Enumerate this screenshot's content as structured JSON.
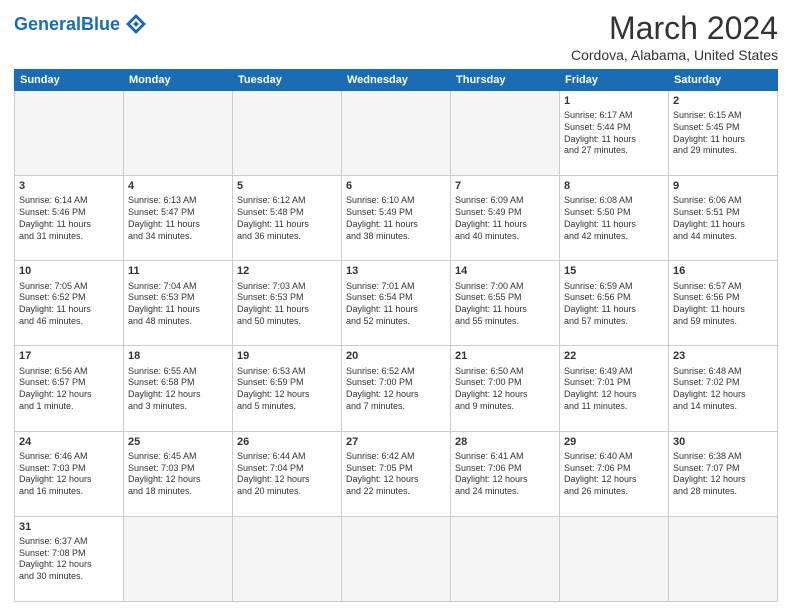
{
  "header": {
    "logo_general": "General",
    "logo_blue": "Blue",
    "month_year": "March 2024",
    "location": "Cordova, Alabama, United States"
  },
  "weekdays": [
    "Sunday",
    "Monday",
    "Tuesday",
    "Wednesday",
    "Thursday",
    "Friday",
    "Saturday"
  ],
  "weeks": [
    [
      {
        "day": "",
        "info": ""
      },
      {
        "day": "",
        "info": ""
      },
      {
        "day": "",
        "info": ""
      },
      {
        "day": "",
        "info": ""
      },
      {
        "day": "",
        "info": ""
      },
      {
        "day": "1",
        "info": "Sunrise: 6:17 AM\nSunset: 5:44 PM\nDaylight: 11 hours\nand 27 minutes."
      },
      {
        "day": "2",
        "info": "Sunrise: 6:15 AM\nSunset: 5:45 PM\nDaylight: 11 hours\nand 29 minutes."
      }
    ],
    [
      {
        "day": "3",
        "info": "Sunrise: 6:14 AM\nSunset: 5:46 PM\nDaylight: 11 hours\nand 31 minutes."
      },
      {
        "day": "4",
        "info": "Sunrise: 6:13 AM\nSunset: 5:47 PM\nDaylight: 11 hours\nand 34 minutes."
      },
      {
        "day": "5",
        "info": "Sunrise: 6:12 AM\nSunset: 5:48 PM\nDaylight: 11 hours\nand 36 minutes."
      },
      {
        "day": "6",
        "info": "Sunrise: 6:10 AM\nSunset: 5:49 PM\nDaylight: 11 hours\nand 38 minutes."
      },
      {
        "day": "7",
        "info": "Sunrise: 6:09 AM\nSunset: 5:49 PM\nDaylight: 11 hours\nand 40 minutes."
      },
      {
        "day": "8",
        "info": "Sunrise: 6:08 AM\nSunset: 5:50 PM\nDaylight: 11 hours\nand 42 minutes."
      },
      {
        "day": "9",
        "info": "Sunrise: 6:06 AM\nSunset: 5:51 PM\nDaylight: 11 hours\nand 44 minutes."
      }
    ],
    [
      {
        "day": "10",
        "info": "Sunrise: 7:05 AM\nSunset: 6:52 PM\nDaylight: 11 hours\nand 46 minutes."
      },
      {
        "day": "11",
        "info": "Sunrise: 7:04 AM\nSunset: 6:53 PM\nDaylight: 11 hours\nand 48 minutes."
      },
      {
        "day": "12",
        "info": "Sunrise: 7:03 AM\nSunset: 6:53 PM\nDaylight: 11 hours\nand 50 minutes."
      },
      {
        "day": "13",
        "info": "Sunrise: 7:01 AM\nSunset: 6:54 PM\nDaylight: 11 hours\nand 52 minutes."
      },
      {
        "day": "14",
        "info": "Sunrise: 7:00 AM\nSunset: 6:55 PM\nDaylight: 11 hours\nand 55 minutes."
      },
      {
        "day": "15",
        "info": "Sunrise: 6:59 AM\nSunset: 6:56 PM\nDaylight: 11 hours\nand 57 minutes."
      },
      {
        "day": "16",
        "info": "Sunrise: 6:57 AM\nSunset: 6:56 PM\nDaylight: 11 hours\nand 59 minutes."
      }
    ],
    [
      {
        "day": "17",
        "info": "Sunrise: 6:56 AM\nSunset: 6:57 PM\nDaylight: 12 hours\nand 1 minute."
      },
      {
        "day": "18",
        "info": "Sunrise: 6:55 AM\nSunset: 6:58 PM\nDaylight: 12 hours\nand 3 minutes."
      },
      {
        "day": "19",
        "info": "Sunrise: 6:53 AM\nSunset: 6:59 PM\nDaylight: 12 hours\nand 5 minutes."
      },
      {
        "day": "20",
        "info": "Sunrise: 6:52 AM\nSunset: 7:00 PM\nDaylight: 12 hours\nand 7 minutes."
      },
      {
        "day": "21",
        "info": "Sunrise: 6:50 AM\nSunset: 7:00 PM\nDaylight: 12 hours\nand 9 minutes."
      },
      {
        "day": "22",
        "info": "Sunrise: 6:49 AM\nSunset: 7:01 PM\nDaylight: 12 hours\nand 11 minutes."
      },
      {
        "day": "23",
        "info": "Sunrise: 6:48 AM\nSunset: 7:02 PM\nDaylight: 12 hours\nand 14 minutes."
      }
    ],
    [
      {
        "day": "24",
        "info": "Sunrise: 6:46 AM\nSunset: 7:03 PM\nDaylight: 12 hours\nand 16 minutes."
      },
      {
        "day": "25",
        "info": "Sunrise: 6:45 AM\nSunset: 7:03 PM\nDaylight: 12 hours\nand 18 minutes."
      },
      {
        "day": "26",
        "info": "Sunrise: 6:44 AM\nSunset: 7:04 PM\nDaylight: 12 hours\nand 20 minutes."
      },
      {
        "day": "27",
        "info": "Sunrise: 6:42 AM\nSunset: 7:05 PM\nDaylight: 12 hours\nand 22 minutes."
      },
      {
        "day": "28",
        "info": "Sunrise: 6:41 AM\nSunset: 7:06 PM\nDaylight: 12 hours\nand 24 minutes."
      },
      {
        "day": "29",
        "info": "Sunrise: 6:40 AM\nSunset: 7:06 PM\nDaylight: 12 hours\nand 26 minutes."
      },
      {
        "day": "30",
        "info": "Sunrise: 6:38 AM\nSunset: 7:07 PM\nDaylight: 12 hours\nand 28 minutes."
      }
    ],
    [
      {
        "day": "31",
        "info": "Sunrise: 6:37 AM\nSunset: 7:08 PM\nDaylight: 12 hours\nand 30 minutes."
      },
      {
        "day": "",
        "info": ""
      },
      {
        "day": "",
        "info": ""
      },
      {
        "day": "",
        "info": ""
      },
      {
        "day": "",
        "info": ""
      },
      {
        "day": "",
        "info": ""
      },
      {
        "day": "",
        "info": ""
      }
    ]
  ]
}
